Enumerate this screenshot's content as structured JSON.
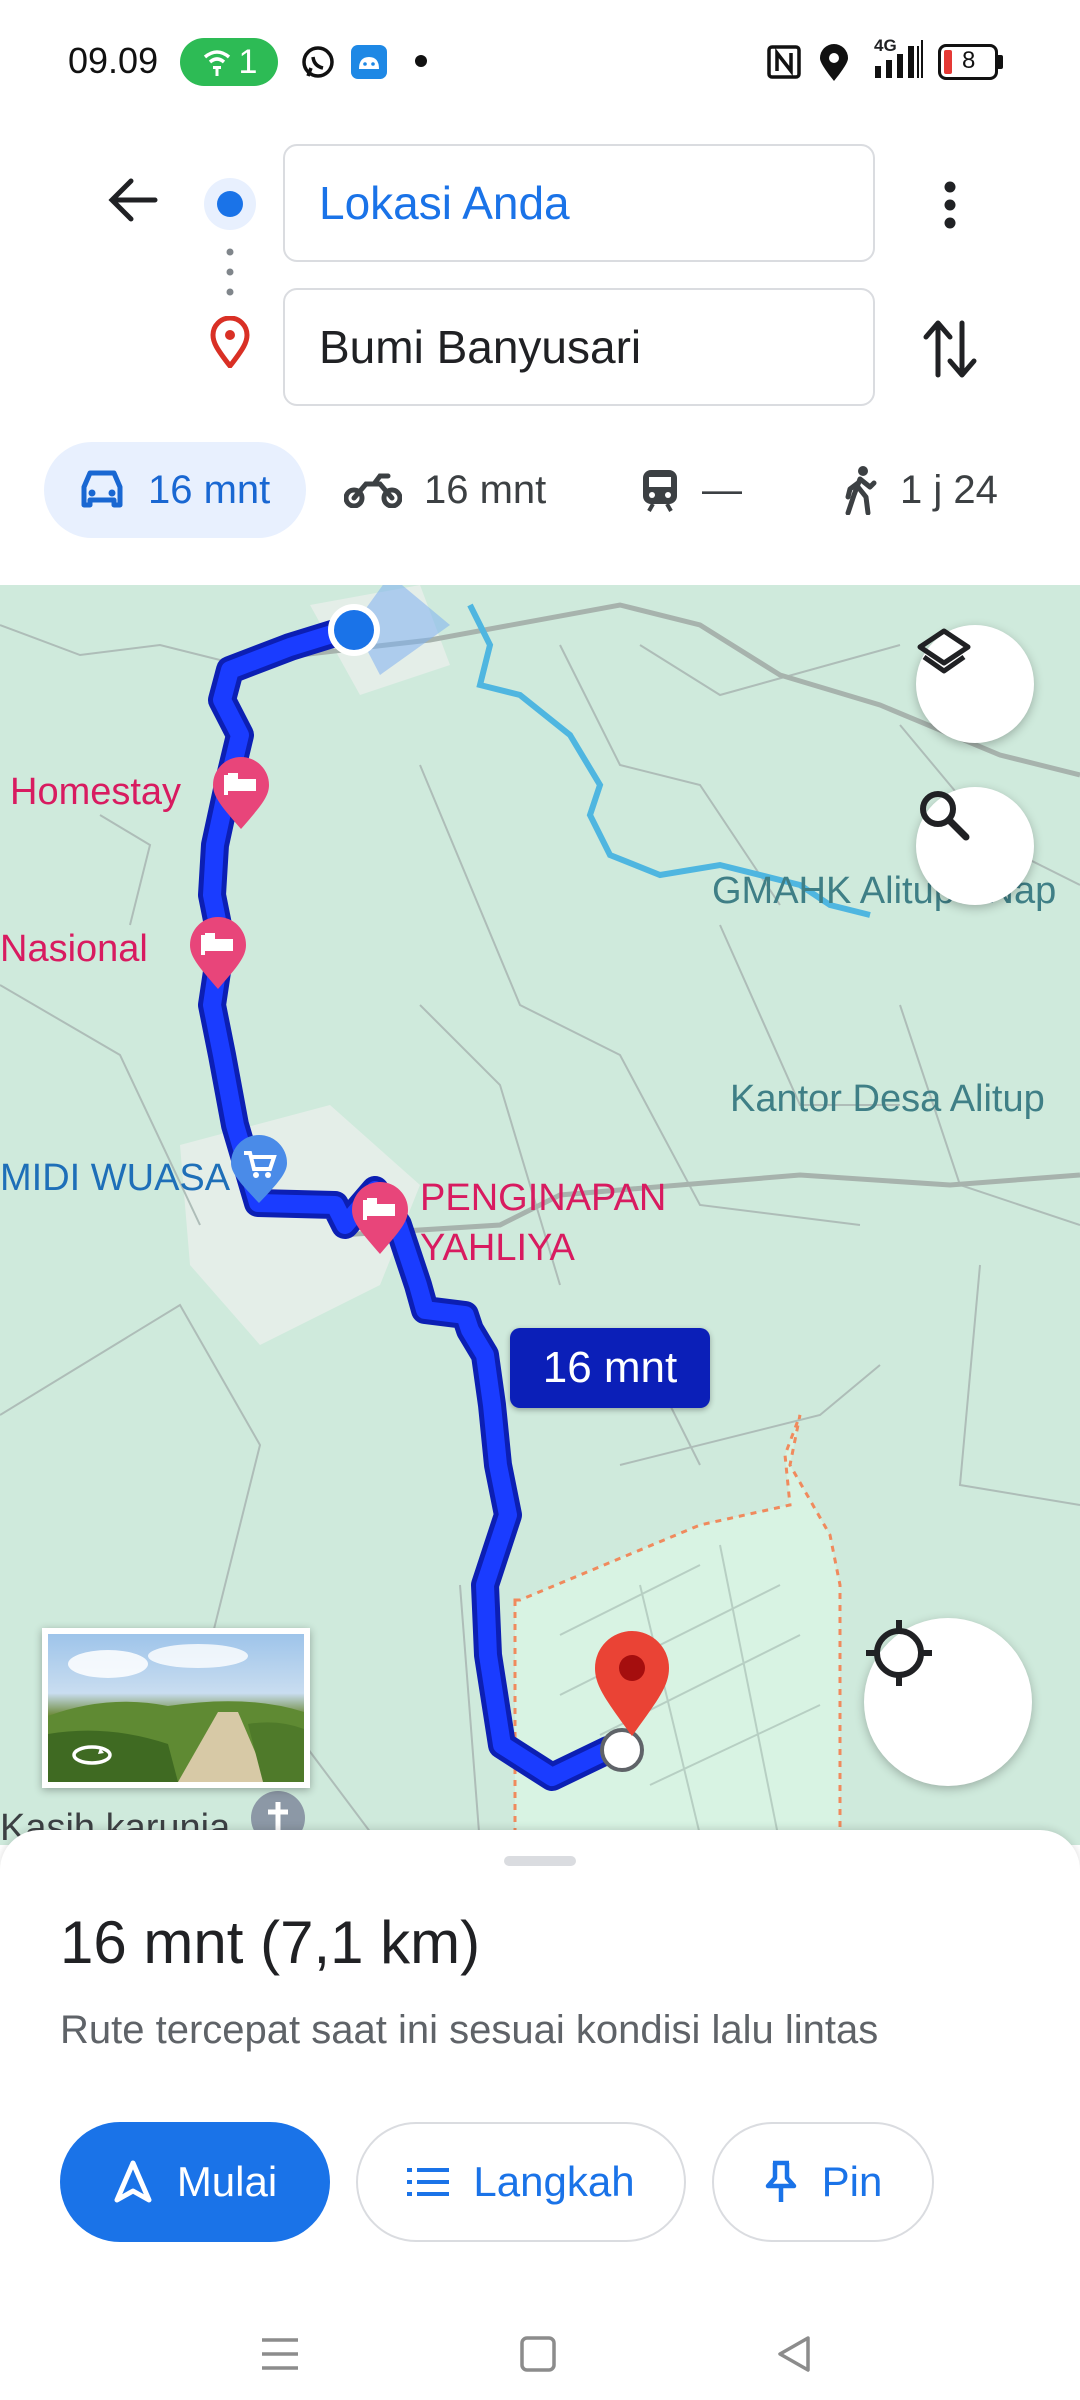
{
  "status_bar": {
    "time": "09.09",
    "wifi_count": "1",
    "icons": [
      "wifi-hotspot-icon",
      "whatsapp-icon",
      "android-icon",
      "dot-icon",
      "nfc-icon",
      "location-icon",
      "signal-4g-icon",
      "battery-icon"
    ],
    "network": "4G",
    "battery": "8"
  },
  "search": {
    "origin": "Lokasi Anda",
    "destination": "Bumi Banyusari"
  },
  "modes": [
    {
      "name": "car",
      "label": "16 mnt",
      "active": true
    },
    {
      "name": "motorcycle",
      "label": "16 mnt",
      "active": false
    },
    {
      "name": "transit",
      "label": "—",
      "active": false
    },
    {
      "name": "walk",
      "label": "1 j 24",
      "active": false
    }
  ],
  "map": {
    "labels": {
      "homestay": "Homestay",
      "nasional": "Nasional",
      "midi_wuasa": "MIDI WUASA",
      "penginapan": "PENGINAPAN",
      "penginapan_line2": "YAHLIYA",
      "gmahk": "GMAHK Alitupu Nap",
      "kantor_desa": "Kantor Desa Alitup",
      "kasih_karunia": "Kasih karunia"
    },
    "eta_chip": "16 mnt",
    "colors": {
      "route": "#1a3cff",
      "route_outline": "#0c1fb3",
      "map_bg": "#cfeadc",
      "river": "#4fb6e0",
      "poi": "#e8457a",
      "destination_pin": "#ea4335"
    }
  },
  "sheet": {
    "summary": "16 mnt (7,1 km)",
    "subtitle": "Rute tercepat saat ini sesuai kondisi lalu lintas",
    "buttons": {
      "start": "Mulai",
      "steps": "Langkah",
      "pin": "Pin"
    }
  },
  "colors": {
    "accent": "#1a73e8",
    "active_chip_bg": "#e8f0fe"
  }
}
